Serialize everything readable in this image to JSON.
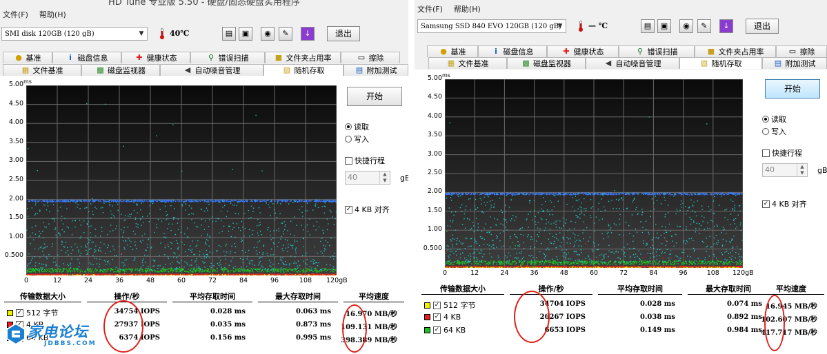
{
  "left": {
    "title_partial": "HD Tune 专业版 5.50 - 硬盘/固态硬盘实用程序",
    "menu": [
      "文件(F)",
      "帮助(H)"
    ],
    "drive": "SMI disk  120GB (120 gB)",
    "temperature": "40℃",
    "exit_label": "退出",
    "tabs_row1": [
      {
        "label": "基准",
        "icon": "bulb-icon"
      },
      {
        "label": "磁盘信息",
        "icon": "info-icon"
      },
      {
        "label": "健康状态",
        "icon": "health-cross-icon"
      },
      {
        "label": "错误扫描",
        "icon": "magnifier-icon"
      },
      {
        "label": "文件夹占用率",
        "icon": "folder-icon"
      },
      {
        "label": "擦除",
        "icon": "trash-icon"
      }
    ],
    "tabs_row2": [
      {
        "label": "文件基准",
        "icon": "file-bench-icon"
      },
      {
        "label": "磁盘监视器",
        "icon": "monitor-icon"
      },
      {
        "label": "自动噪音管理",
        "icon": "speaker-icon"
      },
      {
        "label": "随机存取",
        "icon": "random-access-icon"
      },
      {
        "label": "附加测试",
        "icon": "extra-tests-icon"
      }
    ],
    "start_label": "开始",
    "read_label": "读取",
    "write_label": "写入",
    "quick_label": "快捷行程",
    "quick_value": "40",
    "quick_unit": "gB",
    "align_label": "4 KB 对齐",
    "table_headers": [
      "传输数据大小",
      "操作/秒",
      "平均存取时间",
      "最大存取时间",
      "平均速度"
    ],
    "rows": [
      {
        "size": "512 字节",
        "ops": "34754 IOPS",
        "avg": "0.028 ms",
        "max": "0.063 ms",
        "speed": "16.970 MB/秒",
        "color": "#f0f000"
      },
      {
        "size": "4 KB",
        "ops": "27937 IOPS",
        "avg": "0.035 ms",
        "max": "0.873 ms",
        "speed": "109.131 MB/秒",
        "color": "#e02020"
      },
      {
        "size": "64 KB",
        "ops": "6374 IOPS",
        "avg": "0.156 ms",
        "max": "0.995 ms",
        "speed": "398.389 MB/秒",
        "color": "#20c020"
      }
    ]
  },
  "right": {
    "menu": [
      "文件(F)",
      "帮助(H)"
    ],
    "drive": "Samsung SSD 840 EVO 120GB (120 gB)",
    "temperature": "— ℃",
    "exit_label": "退出",
    "tabs_row1": [
      {
        "label": "基准",
        "icon": "bulb-icon"
      },
      {
        "label": "磁盘信息",
        "icon": "info-icon"
      },
      {
        "label": "健康状态",
        "icon": "health-cross-icon"
      },
      {
        "label": "错误扫描",
        "icon": "magnifier-icon"
      },
      {
        "label": "文件夹占用率",
        "icon": "folder-icon"
      },
      {
        "label": "擦除",
        "icon": "trash-icon"
      }
    ],
    "tabs_row2": [
      {
        "label": "文件基准",
        "icon": "file-bench-icon"
      },
      {
        "label": "磁盘监视器",
        "icon": "monitor-icon"
      },
      {
        "label": "自动噪音管理",
        "icon": "speaker-icon"
      },
      {
        "label": "随机存取",
        "icon": "random-access-icon"
      },
      {
        "label": "附加测试",
        "icon": "extra-tests-icon"
      }
    ],
    "start_label": "开始",
    "read_label": "读取",
    "write_label": "写入",
    "quick_label": "快捷行程",
    "quick_value": "40",
    "quick_unit": "gB",
    "align_label": "4 KB 对齐",
    "table_headers": [
      "传输数据大小",
      "操作/秒",
      "平均存取时间",
      "最大存取时间",
      "平均速度"
    ],
    "rows": [
      {
        "size": "512 字节",
        "ops": "34704 IOPS",
        "avg": "0.028 ms",
        "max": "0.074 ms",
        "speed": "16.945 MB/秒",
        "color": "#f0f000"
      },
      {
        "size": "4 KB",
        "ops": "26267 IOPS",
        "avg": "0.038 ms",
        "max": "0.892 ms",
        "speed": "102.607 MB/秒",
        "color": "#e02020"
      },
      {
        "size": "64 KB",
        "ops": "6653 IOPS",
        "avg": "0.149 ms",
        "max": "0.984 ms",
        "speed": "417.717 MB/秒",
        "color": "#20c020"
      }
    ]
  },
  "watermark": {
    "title": "家电论坛",
    "url": "JDBBS.COM"
  },
  "chart_data": [
    {
      "type": "scatter",
      "title": "",
      "xlabel": "",
      "ylabel": "ms",
      "x_unit": "gB",
      "xlim": [
        0,
        120
      ],
      "ylim": [
        0,
        5.0
      ],
      "x_ticks": [
        0,
        12,
        24,
        36,
        48,
        60,
        72,
        84,
        96,
        108,
        120
      ],
      "y_ticks": [
        "0.500",
        "1.00",
        "1.50",
        "2.00",
        "2.50",
        "3.00",
        "3.50",
        "4.00",
        "4.50",
        "5.00"
      ],
      "grid": true,
      "series": [
        {
          "color": "#f0f000",
          "band_ms": [
            0.02,
            0.04
          ],
          "max_ms": 0.063
        },
        {
          "color": "#e02020",
          "band_ms": [
            0.03,
            0.05
          ],
          "max_ms": 0.873
        },
        {
          "color": "#20c020",
          "band_ms": [
            0.1,
            0.2
          ],
          "max_ms": 0.995
        },
        {
          "color": "#3a7cff",
          "band_ms": [
            1.95,
            2.0
          ],
          "max_ms": 2.0
        },
        {
          "color": "#27c4c4",
          "band_ms": [
            0.15,
            2.0
          ],
          "max_ms": 4.7
        }
      ]
    },
    {
      "type": "scatter",
      "title": "",
      "xlabel": "",
      "ylabel": "ms",
      "x_unit": "gB",
      "xlim": [
        0,
        120
      ],
      "ylim": [
        0,
        5.0
      ],
      "x_ticks": [
        0,
        12,
        24,
        36,
        48,
        60,
        72,
        84,
        96,
        108,
        120
      ],
      "y_ticks": [
        "0.500",
        "1.00",
        "1.50",
        "2.00",
        "2.50",
        "3.00",
        "3.50",
        "4.00",
        "4.50",
        "5.00"
      ],
      "grid": true,
      "series": [
        {
          "color": "#f0f000",
          "band_ms": [
            0.02,
            0.04
          ],
          "max_ms": 0.074
        },
        {
          "color": "#e02020",
          "band_ms": [
            0.03,
            0.06
          ],
          "max_ms": 0.892
        },
        {
          "color": "#20c020",
          "band_ms": [
            0.1,
            0.2
          ],
          "max_ms": 0.984
        },
        {
          "color": "#3a7cff",
          "band_ms": [
            1.95,
            2.0
          ],
          "max_ms": 2.0
        },
        {
          "color": "#27c4c4",
          "band_ms": [
            0.15,
            2.0
          ],
          "max_ms": 4.7
        }
      ]
    }
  ]
}
